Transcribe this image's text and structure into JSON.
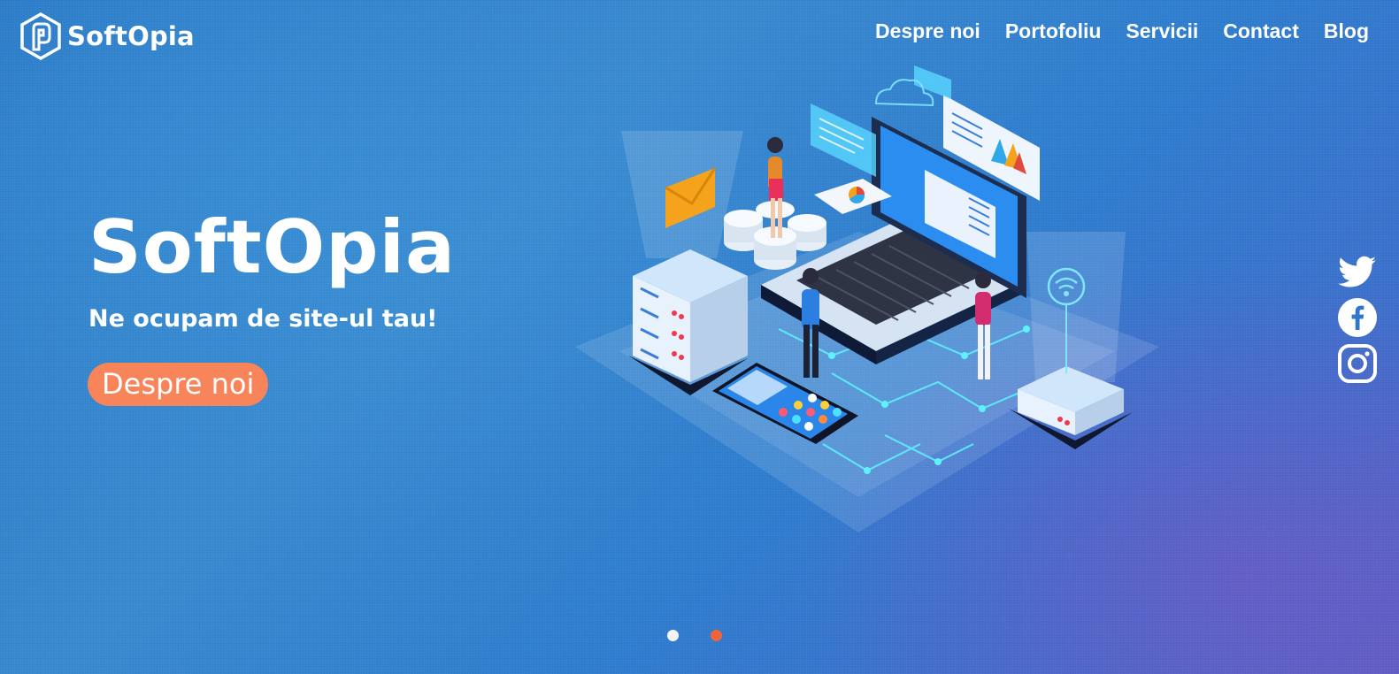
{
  "brand": {
    "name": "SoftOpia",
    "icon": "softopia-logo-icon"
  },
  "nav": {
    "items": [
      {
        "label": "Despre noi"
      },
      {
        "label": "Portofoliu"
      },
      {
        "label": "Servicii"
      },
      {
        "label": "Contact"
      },
      {
        "label": "Blog"
      }
    ]
  },
  "hero": {
    "title": "SoftOpia",
    "subtitle": "Ne ocupam de site-ul tau!",
    "button_label": "Despre noi",
    "illustration": "isometric-tech-illustration"
  },
  "social": [
    {
      "icon": "twitter-icon"
    },
    {
      "icon": "facebook-icon"
    },
    {
      "icon": "instagram-icon"
    }
  ],
  "slider": {
    "slides": 2,
    "active": 1
  },
  "colors": {
    "accent": "#f8845a",
    "background_start": "#2a78c6",
    "background_end": "#5b5fc4",
    "dot_inactive": "#ffffff",
    "dot_active": "#f0643c"
  }
}
